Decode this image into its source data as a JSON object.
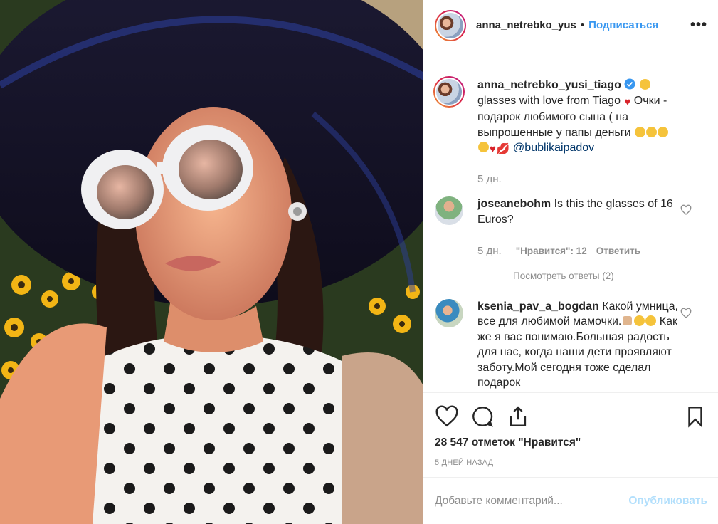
{
  "header": {
    "username": "anna_netrebko_yus",
    "separator": "•",
    "follow_label": "Подписаться",
    "more_label": "•••",
    "avatar_icon": "profile-photo-avatar"
  },
  "caption": {
    "username": "anna_netrebko_yusi_tiago",
    "verified_icon": "verified-badge-icon",
    "text_part1": "glasses with love from Tiago",
    "text_part2": "Очки - подарок любимого сына ( на выпрошенные у папы деньги",
    "mention": "@bublikaipadov",
    "time": "5 дн."
  },
  "comments": [
    {
      "username": "joseanebohm",
      "text": "Is this the glasses of 16 Euros?",
      "time": "5 дн.",
      "likes": "\"Нравится\": 12",
      "reply_label": "Ответить",
      "view_replies": "Посмотреть ответы (2)"
    },
    {
      "username": "ksenia_pav_a_bogdan",
      "text_part1": "Какой умница, все для любимой мамочки.",
      "text_part2": "Как же я вас понимаю.Большая радость для нас, когда наши дети проявляют заботу.Мой сегодня тоже сделал",
      "text_part3": "подарок"
    }
  ],
  "actions": {
    "like_icon": "heart-icon",
    "comment_icon": "comment-icon",
    "share_icon": "share-icon",
    "save_icon": "bookmark-icon",
    "likes_text": "28 547 отметок \"Нравится\"",
    "posted_ago": "5 ДНЕЙ НАЗАД"
  },
  "add_comment": {
    "placeholder": "Добавьте комментарий...",
    "publish_label": "Опубликовать"
  },
  "colors": {
    "link_blue": "#3897f0",
    "mention_blue": "#003569",
    "muted_gray": "#8e8e8e",
    "verified_blue": "#3897f0",
    "publish_disabled": "#b2dffc"
  }
}
